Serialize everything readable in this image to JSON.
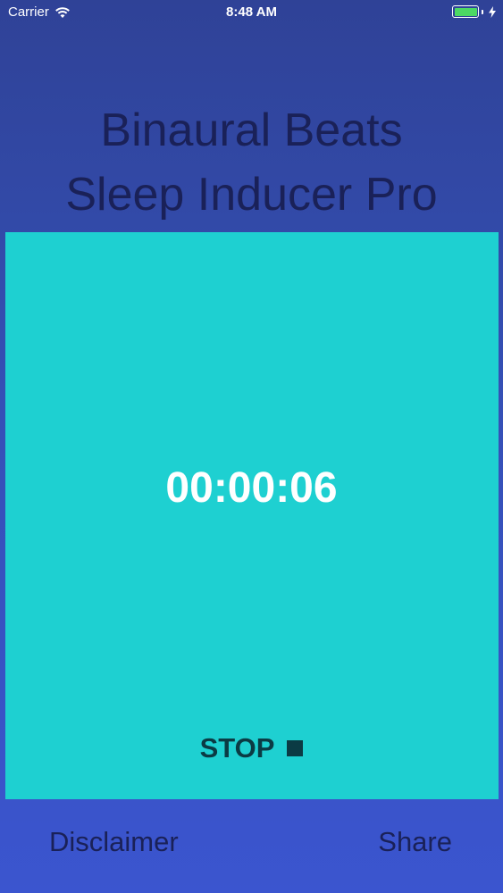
{
  "status_bar": {
    "carrier": "Carrier",
    "time": "8:48 AM",
    "wifi_icon": "wifi-icon",
    "battery_icon": "battery-icon",
    "charging_icon": "bolt-icon",
    "battery_color": "#4cd964"
  },
  "title": {
    "line1": "Binaural Beats",
    "line2": "Sleep Inducer Pro"
  },
  "timer": {
    "elapsed": "00:00:06",
    "panel_color": "#1ed0d1",
    "stop_label": "STOP",
    "stop_icon": "stop-square-icon"
  },
  "footer": {
    "disclaimer_label": "Disclaimer",
    "share_label": "Share"
  }
}
